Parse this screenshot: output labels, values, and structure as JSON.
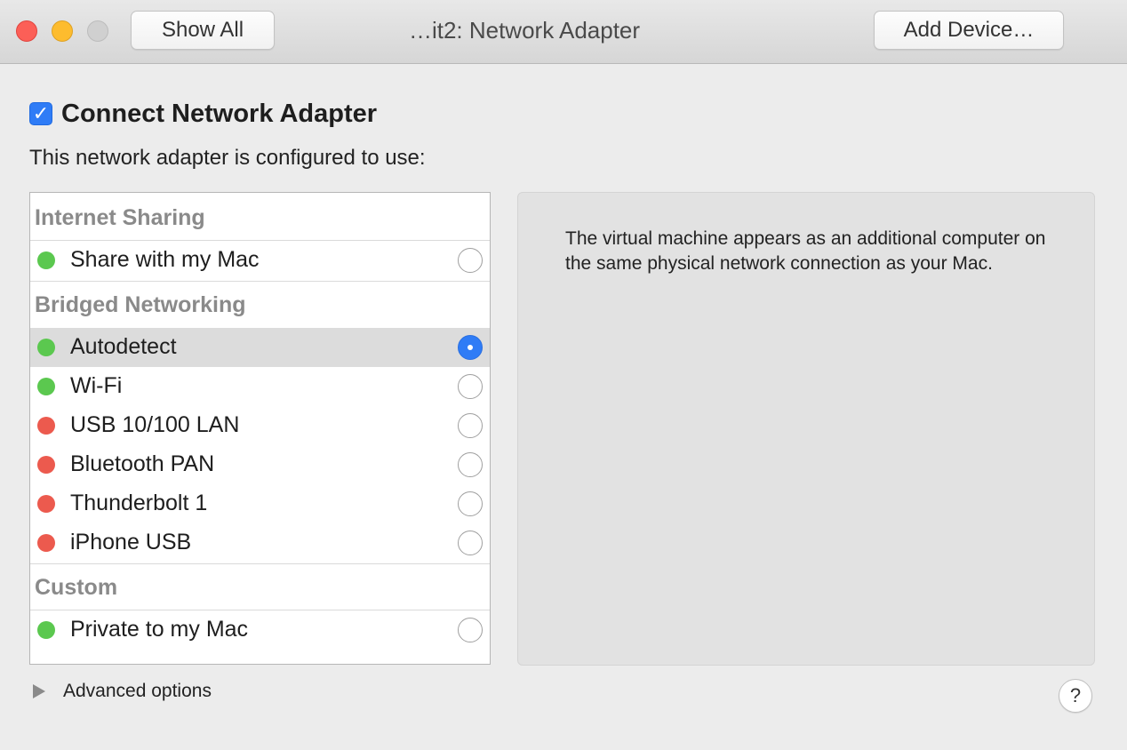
{
  "titlebar": {
    "title": "…it2: Network Adapter",
    "show_all_label": "Show All",
    "add_device_label": "Add Device…"
  },
  "connect": {
    "label": "Connect Network Adapter",
    "checked": true,
    "check_glyph": "✓"
  },
  "configured_label": "This network adapter is configured to use:",
  "list": {
    "groups": [
      {
        "header": "Internet Sharing",
        "items": [
          {
            "label": "Share with my Mac",
            "status": "green",
            "selected": false
          }
        ]
      },
      {
        "header": "Bridged Networking",
        "items": [
          {
            "label": "Autodetect",
            "status": "green",
            "selected": true
          },
          {
            "label": "Wi-Fi",
            "status": "green",
            "selected": false
          },
          {
            "label": "USB 10/100 LAN",
            "status": "red",
            "selected": false
          },
          {
            "label": "Bluetooth PAN",
            "status": "red",
            "selected": false
          },
          {
            "label": "Thunderbolt 1",
            "status": "red",
            "selected": false
          },
          {
            "label": "iPhone USB",
            "status": "red",
            "selected": false
          }
        ]
      },
      {
        "header": "Custom",
        "items": [
          {
            "label": "Private to my Mac",
            "status": "green",
            "selected": false
          }
        ]
      }
    ]
  },
  "description": "The virtual machine appears as an additional computer on the same physical network connection as your Mac.",
  "footer": {
    "advanced_label": "Advanced options",
    "help_glyph": "?"
  },
  "colors": {
    "status_green": "#5bc84f",
    "status_red": "#ec5a4e",
    "accent": "#2f7cf6"
  },
  "icons": {
    "close": "close-window-icon",
    "minimize": "minimize-window-icon",
    "zoom": "zoom-window-icon",
    "disclosure": "disclosure-triangle-icon",
    "help": "help-icon"
  }
}
